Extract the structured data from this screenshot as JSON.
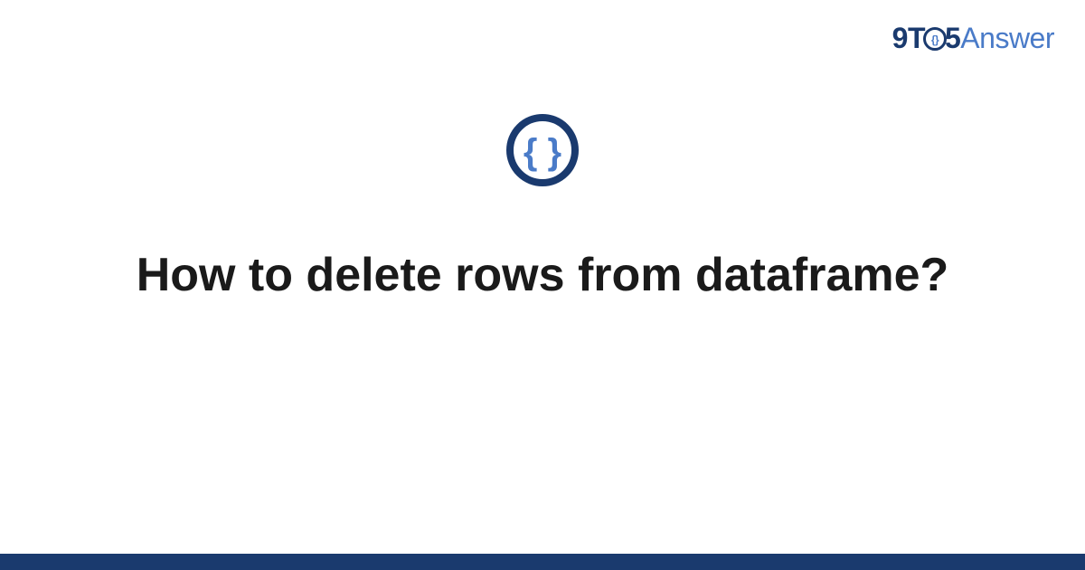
{
  "brand": {
    "part1": "9T",
    "part2": "5",
    "part3": "Answer"
  },
  "icon": {
    "name": "braces-icon"
  },
  "title": "How to delete rows from dataframe?",
  "colors": {
    "primary_dark": "#1a3a6e",
    "primary_light": "#4a7bc8",
    "text": "#1a1a1a"
  }
}
